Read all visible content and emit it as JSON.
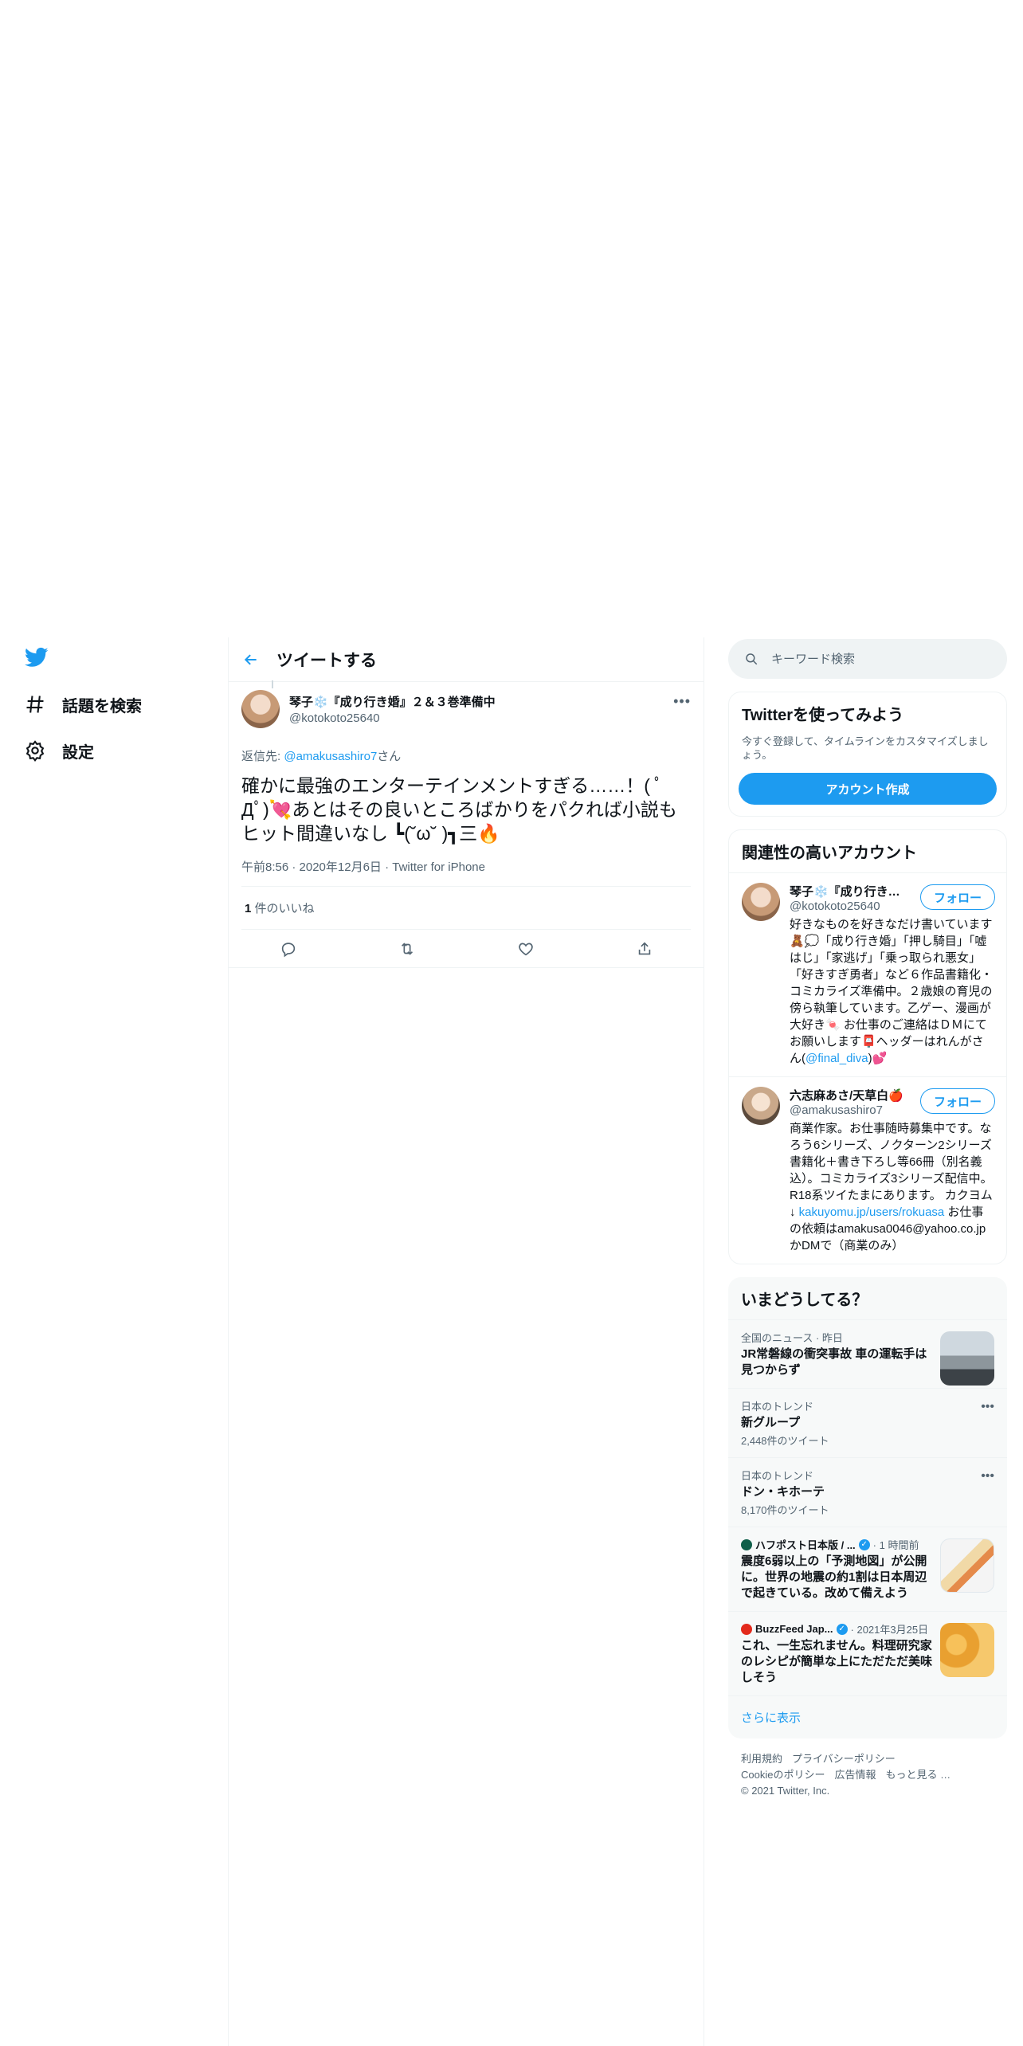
{
  "colors": {
    "accent": "#1d9bf0",
    "text": "#0f1419",
    "muted": "#536471"
  },
  "nav": {
    "logo_icon": "twitter-bird-icon",
    "items": [
      {
        "label": "話題を検索",
        "icon": "hashtag-icon"
      },
      {
        "label": "設定",
        "icon": "gear-icon"
      }
    ]
  },
  "header": {
    "title": "ツイートする"
  },
  "tweet": {
    "display_name": "琴子❄️『成り行き婚』２＆３巻準備中",
    "handle": "@kotokoto25640",
    "reply_prefix": "返信先: ",
    "reply_handle": "@amakusashiro7",
    "reply_suffix": "さん",
    "text": "確かに最強のエンターテインメントすぎる……！( ﾟДﾟ)💘あとはその良いところばかりをパクれば小説もヒット間違いなし ┗(˘ω˘ )┓三🔥",
    "meta": "午前8:56 · 2020年12月6日 · Twitter for iPhone",
    "likes_count": "1",
    "likes_label": " 件のいいね"
  },
  "search": {
    "placeholder": "キーワード検索"
  },
  "join": {
    "title": "Twitterを使ってみよう",
    "desc": "今すぐ登録して、タイムラインをカスタマイズしましょう。",
    "button": "アカウント作成"
  },
  "relevant": {
    "title": "関連性の高いアカウント",
    "follow_label": "フォロー",
    "accounts": [
      {
        "name": "琴子❄️『成り行き…",
        "handle": "@kotokoto25640",
        "bio": "好きなものを好きなだけ書いています🧸💭「成り行き婚」「押し騎目」「嘘はじ」「家逃げ」「乗っ取られ悪女」「好きすぎ勇者」など６作品書籍化・コミカライズ準備中。２歳娘の育児の傍ら執筆しています。乙ゲー、漫画が大好き🍬 お仕事のご連絡はＤＭにてお願いします📮ヘッダーはれんがさん(",
        "bio_link": "@final_diva",
        "bio_end": ")💕"
      },
      {
        "name": "六志麻あさ/天草白🍎",
        "handle": "@amakusashiro7",
        "bio": "商業作家。お仕事随時募集中です。なろう6シリーズ、ノクターン2シリーズ書籍化＋書き下ろし等66冊（別名義込）。コミカライズ3シリーズ配信中。R18系ツイたまにあります。 カクヨム↓ ",
        "bio_link": "kakuyomu.jp/users/rokuasa",
        "bio_end": " お仕事の依頼はamakusa0046@yahoo.co.jpかDMで（商業のみ）"
      }
    ]
  },
  "trends": {
    "title": "いまどうしてる？",
    "items": [
      {
        "context": "全国のニュース · 昨日",
        "name": "JR常磐線の衝突事故 車の運転手は見つからず",
        "thumb": "news-photo"
      },
      {
        "context": "日本のトレンド",
        "name": "新グループ",
        "count": "2,448件のツイート"
      },
      {
        "context": "日本のトレンド",
        "name": "ドン・キホーテ",
        "count": "8,170件のツイート"
      },
      {
        "source": "ハフポスト日本版 / ...",
        "time": " · 1 時間前",
        "name": "震度6弱以上の「予測地図」が公開に。世界の地震の約1割は日本周辺で起きている。改めて備えよう",
        "thumb": "map-image"
      },
      {
        "source": "BuzzFeed Jap...",
        "time": " · 2021年3月25日",
        "name": "これ、一生忘れません。料理研究家のレシピが簡単な上にただただ美味しそう",
        "thumb": "food-photo"
      }
    ],
    "show_more": "さらに表示"
  },
  "footer": {
    "links": [
      "利用規約",
      "プライバシーポリシー",
      "Cookieのポリシー",
      "広告情報",
      "もっと見る …"
    ],
    "copyright": "© 2021 Twitter, Inc."
  }
}
